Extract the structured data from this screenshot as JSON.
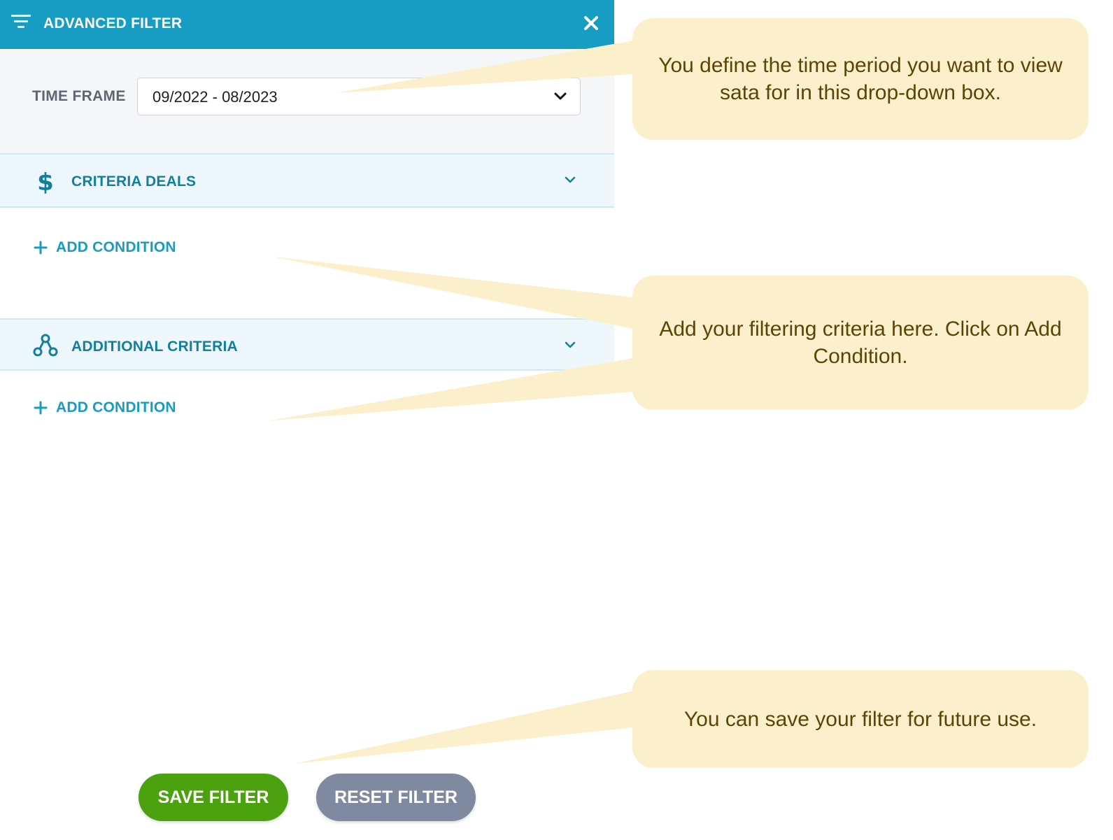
{
  "panel": {
    "title": "ADVANCED FILTER",
    "time_frame": {
      "label": "TIME FRAME",
      "selected": "09/2022 - 08/2023"
    },
    "sections": [
      {
        "title": "CRITERIA DEALS",
        "icon": "dollar-icon",
        "add_condition": "ADD CONDITION"
      },
      {
        "title": "ADDITIONAL CRITERIA",
        "icon": "network-icon",
        "add_condition": "ADD CONDITION"
      }
    ],
    "buttons": {
      "save": "SAVE FILTER",
      "reset": "RESET FILTER"
    }
  },
  "callouts": [
    "You define the time period you want to view sata for in this drop-down box.",
    "Add your filtering criteria here. Click on Add Condition.",
    "You can save your filter for future use."
  ],
  "colors": {
    "header": "#179cc3",
    "accent_text": "#137f9e",
    "save": "#4ba20e",
    "reset": "#7f8aa1",
    "callout_bg": "#fcf0cc",
    "callout_text": "#5a4506"
  }
}
